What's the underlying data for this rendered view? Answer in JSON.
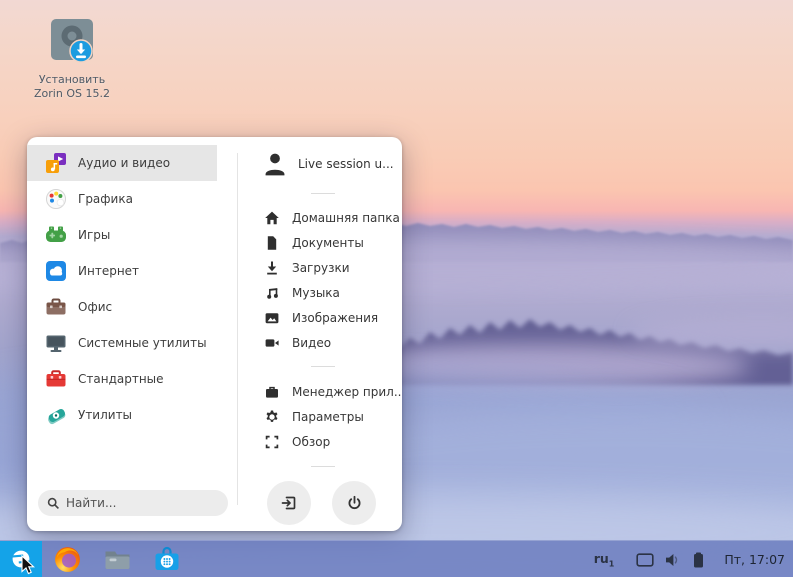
{
  "desktop": {
    "installer_label_line1": "Установить",
    "installer_label_line2": "Zorin OS 15.2",
    "installer_icon": "disk-install-icon"
  },
  "menu": {
    "categories": [
      {
        "label": "Аудио и видео",
        "icon": "audio-video-icon",
        "selected": true
      },
      {
        "label": "Графика",
        "icon": "graphics-icon",
        "selected": false
      },
      {
        "label": "Игры",
        "icon": "games-icon",
        "selected": false
      },
      {
        "label": "Интернет",
        "icon": "internet-icon",
        "selected": false
      },
      {
        "label": "Офис",
        "icon": "office-icon",
        "selected": false
      },
      {
        "label": "Системные утилиты",
        "icon": "system-tools-icon",
        "selected": false
      },
      {
        "label": "Стандартные",
        "icon": "accessories-icon",
        "selected": false
      },
      {
        "label": "Утилиты",
        "icon": "utilities-icon",
        "selected": false
      }
    ],
    "user": {
      "label": "Live session u...",
      "icon": "user-avatar-icon"
    },
    "places": [
      {
        "label": "Домашняя папка",
        "icon": "home-icon"
      },
      {
        "label": "Документы",
        "icon": "document-icon"
      },
      {
        "label": "Загрузки",
        "icon": "download-icon"
      },
      {
        "label": "Музыка",
        "icon": "music-icon"
      },
      {
        "label": "Изображения",
        "icon": "image-icon"
      },
      {
        "label": "Видео",
        "icon": "video-icon"
      }
    ],
    "system_items": [
      {
        "label": "Менеджер прил...",
        "icon": "software-manager-icon"
      },
      {
        "label": "Параметры",
        "icon": "settings-gear-icon"
      },
      {
        "label": "Обзор",
        "icon": "overview-corners-icon"
      }
    ],
    "search": {
      "placeholder": "Найти...",
      "icon": "search-icon"
    },
    "session_buttons": [
      {
        "name": "logout",
        "icon": "logout-icon"
      },
      {
        "name": "power",
        "icon": "power-icon"
      }
    ]
  },
  "taskbar": {
    "apps": [
      {
        "name": "zorin-menu",
        "icon": "zorin-logo-icon",
        "active": true
      },
      {
        "name": "firefox",
        "icon": "firefox-icon",
        "active": false
      },
      {
        "name": "file-manager",
        "icon": "folder-icon",
        "active": false
      },
      {
        "name": "software-store",
        "icon": "store-bag-icon",
        "active": false
      }
    ],
    "tray": {
      "keyboard_layout": "ru",
      "keyboard_layout_variant": "1",
      "icons": [
        "display-icon",
        "volume-icon",
        "battery-icon"
      ],
      "clock": "Пт, 17:07"
    }
  },
  "colors": {
    "zorin_button_blue": "#14a3e8",
    "taskbar_overlay": "rgba(103,120,189,0.80)",
    "menu_selected_row": "#e6e6e6",
    "menu_background": "#ffffff",
    "store_blue": "#17a0e8",
    "sky_peach": "#f8ccb6",
    "fog_lavender": "#b3abd0"
  }
}
